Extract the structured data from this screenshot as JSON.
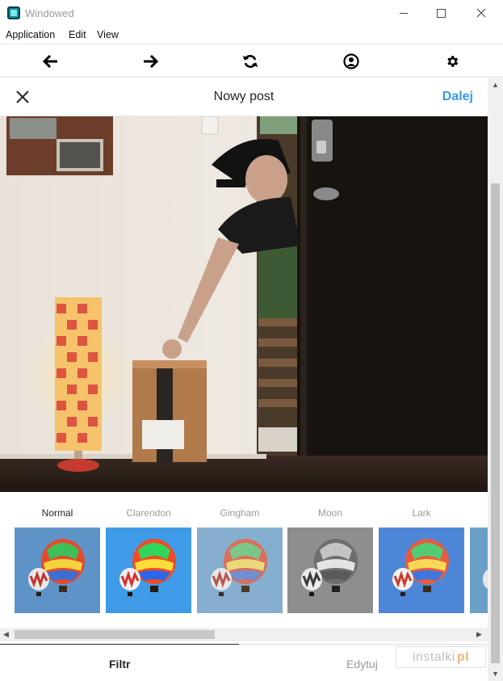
{
  "window": {
    "title": "Windowed",
    "minimize_label": "—",
    "close_glyph": "✕"
  },
  "menu": {
    "items": [
      "Application",
      "Edit",
      "View"
    ]
  },
  "nav": {
    "icons": [
      "arrow-left-icon",
      "arrow-right-icon",
      "refresh-icon",
      "profile-icon",
      "settings-icon"
    ]
  },
  "post": {
    "title": "Nowy post",
    "next_label": "Dalej"
  },
  "filters": [
    {
      "name": "Normal",
      "active": true
    },
    {
      "name": "Clarendon",
      "active": false
    },
    {
      "name": "Gingham",
      "active": false
    },
    {
      "name": "Moon",
      "active": false
    },
    {
      "name": "Lark",
      "active": false
    }
  ],
  "tabs": {
    "filter_label": "Filtr",
    "edit_label": "Edytuj"
  },
  "watermark": {
    "text": "instalki",
    "suffix": "pl"
  },
  "colors": {
    "accent": "#3897f0",
    "text": "#262626",
    "muted": "#9b9b9b"
  }
}
